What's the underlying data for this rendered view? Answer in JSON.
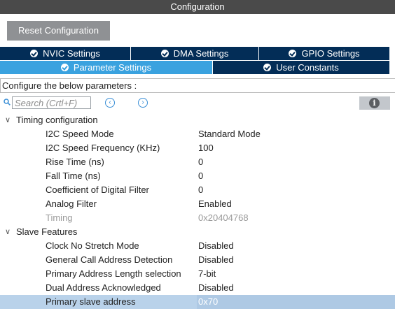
{
  "window": {
    "title": "Configuration"
  },
  "toolbar": {
    "reset_label": "Reset Configuration"
  },
  "tabs_top": [
    {
      "label": "NVIC Settings"
    },
    {
      "label": "DMA Settings"
    },
    {
      "label": "GPIO Settings"
    }
  ],
  "tabs_bottom": [
    {
      "label": "Parameter Settings",
      "active": true
    },
    {
      "label": "User Constants",
      "active": false
    }
  ],
  "configure_text": "Configure the below parameters :",
  "search": {
    "placeholder": "Search (Crtl+F)"
  },
  "icons": {
    "search": "search-icon",
    "prev": "chevron-left-circle-icon",
    "next": "chevron-right-circle-icon",
    "info": "info-icon",
    "check": "check-circle-icon",
    "expand": "chevron-down-icon"
  },
  "colors": {
    "title_bar": "#4a4a4a",
    "tab_dark": "#032d57",
    "tab_active": "#3aa2df",
    "button_gray": "#8f9194",
    "selected_row": "#b9d2ea"
  },
  "groups": [
    {
      "label": "Timing configuration",
      "params": [
        {
          "name": "I2C Speed Mode",
          "value": "Standard Mode"
        },
        {
          "name": "I2C Speed Frequency (KHz)",
          "value": "100"
        },
        {
          "name": "Rise Time (ns)",
          "value": "0"
        },
        {
          "name": "Fall Time (ns)",
          "value": "0"
        },
        {
          "name": "Coefficient of Digital Filter",
          "value": "0"
        },
        {
          "name": "Analog Filter",
          "value": "Enabled"
        },
        {
          "name": "Timing",
          "value": "0x20404768"
        }
      ]
    },
    {
      "label": "Slave Features",
      "params": [
        {
          "name": "Clock No Stretch Mode",
          "value": "Disabled"
        },
        {
          "name": "General Call Address Detection",
          "value": "Disabled"
        },
        {
          "name": "Primary Address Length selection",
          "value": "7-bit"
        },
        {
          "name": "Dual Address Acknowledged",
          "value": "Disabled"
        },
        {
          "name": "Primary slave address",
          "value": "0x70"
        }
      ]
    }
  ]
}
